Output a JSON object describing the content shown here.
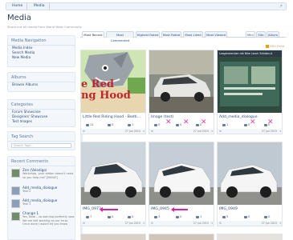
{
  "breadcrumb": {
    "home": "Home",
    "media": "Media"
  },
  "page": {
    "title": "Media",
    "subtitle": "Share out all media from World Wide Community"
  },
  "sidebar": {
    "nav_heading": "Media Navigation",
    "nav_items": [
      "Media Index",
      "Search Media",
      "New Media"
    ],
    "albums_heading": "Albums",
    "albums_items": [
      "Browse Albums"
    ],
    "categories_heading": "Categories",
    "categories_items": [
      "Forum Showcase",
      "Designers' Showcase",
      "Test Images"
    ],
    "tag_heading": "Tag Search",
    "tag_placeholder": "Search Tags...",
    "recent_heading": "Recent Comments",
    "recent": [
      {
        "name": "Zen (Volodigo)",
        "text": "Workshop, your addon doesn't need so you help me? [IMAGE]"
      },
      {
        "name": "Add_media_dialogue",
        "text": "Test 2"
      },
      {
        "name": "Add_media_dialogue",
        "text": "Test 1"
      },
      {
        "name": "Change 1",
        "text": "Yes, Note - no warning perfectly now. We are still working on our error. Once done I would let you know"
      }
    ]
  },
  "tabs": [
    "Most Recent",
    "Most Commented",
    "Highest Rated",
    "Most Rated",
    "Most Liked",
    "Most Viewed"
  ],
  "view_tabs": [
    "Mini",
    "Site",
    "Album"
  ],
  "rss_label": "RSS Feed",
  "cards": [
    {
      "caption": "Little Red Riding Hood - Bedti...",
      "views": "11",
      "comments": "0",
      "likes": "1",
      "date": "27 Jun 2015"
    },
    {
      "caption": "Image (test)",
      "views": "0",
      "comments": "0",
      "likes": "0",
      "date": "27 Jun 2015"
    },
    {
      "caption": "Add_media_dialogue",
      "views": "1",
      "comments": "0",
      "likes": "0",
      "date": "27 Jun 2015"
    },
    {
      "caption": "IMG_0973",
      "views": "7",
      "comments": "0",
      "likes": "0",
      "date": "27 Jun 2015"
    },
    {
      "caption": "IMG_0945",
      "views": "3",
      "comments": "0",
      "likes": "1",
      "date": "27 Jun 2015"
    },
    {
      "caption": "IMG_0949",
      "views": "5",
      "comments": "0",
      "likes": "0",
      "date": "27 Jun 2015"
    }
  ],
  "thumb_banner_text": "Laagerstrecken mit Nike Lauch Schlden.A",
  "hood_text_1": "e Red",
  "hood_text_2": "ng Hood",
  "colors": {
    "accent": "#2b4c7e",
    "annotation": "#e0209a",
    "panel": "#f3f7fc"
  }
}
